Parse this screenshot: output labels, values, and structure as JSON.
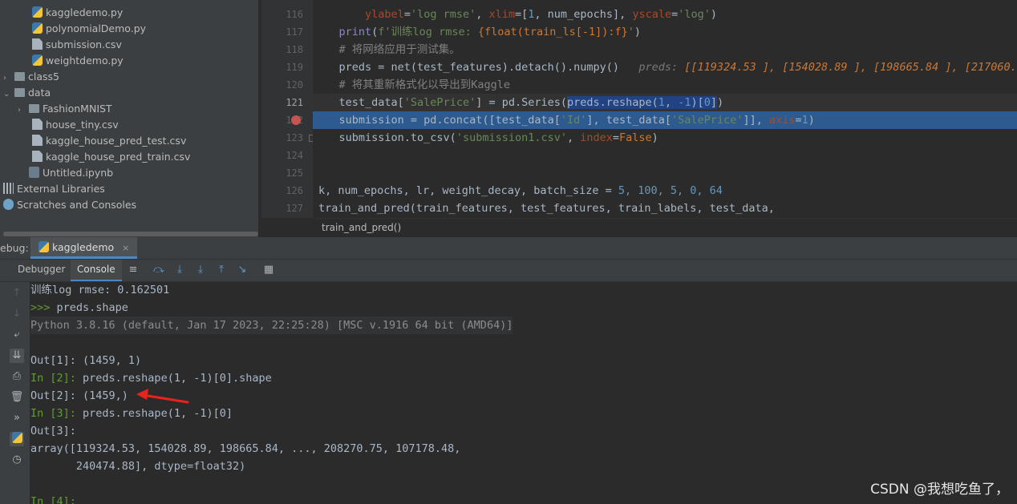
{
  "project_tree": {
    "items": [
      {
        "label": "kaggledemo.py",
        "icon": "python-file-icon",
        "indent": 2,
        "arrow": ""
      },
      {
        "label": "polynomialDemo.py",
        "icon": "python-file-icon",
        "indent": 2,
        "arrow": ""
      },
      {
        "label": "submission.csv",
        "icon": "csv-file-icon",
        "indent": 2,
        "arrow": ""
      },
      {
        "label": "weightdemo.py",
        "icon": "python-file-icon",
        "indent": 2,
        "arrow": ""
      },
      {
        "label": "class5",
        "icon": "folder-icon",
        "indent": 0,
        "arrow": "›"
      },
      {
        "label": "data",
        "icon": "folder-icon",
        "indent": 0,
        "arrow": "⌄"
      },
      {
        "label": "FashionMNIST",
        "icon": "folder-icon",
        "indent": 1,
        "arrow": "›"
      },
      {
        "label": "house_tiny.csv",
        "icon": "csv-file-icon",
        "indent": 2,
        "arrow": ""
      },
      {
        "label": "kaggle_house_pred_test.csv",
        "icon": "csv-file-icon",
        "indent": 2,
        "arrow": ""
      },
      {
        "label": "kaggle_house_pred_train.csv",
        "icon": "csv-file-icon",
        "indent": 2,
        "arrow": ""
      },
      {
        "label": "Untitled.ipynb",
        "icon": "notebook-file-icon",
        "indent": 1,
        "arrow": ""
      },
      {
        "label": "External Libraries",
        "icon": "libraries-icon",
        "indent": -1,
        "arrow": ""
      },
      {
        "label": "Scratches and Consoles",
        "icon": "scratches-icon",
        "indent": -1,
        "arrow": ""
      }
    ]
  },
  "editor": {
    "line_numbers": [
      "116",
      "117",
      "118",
      "119",
      "120",
      "121",
      "122",
      "123",
      "124",
      "125",
      "126",
      "127"
    ],
    "lines": {
      "l116_a": "        ",
      "l116_param": "ylabel",
      "l116_b": "=",
      "l116_s1": "'log rmse'",
      "l116_c": ", ",
      "l116_param2": "xlim",
      "l116_d": "=[",
      "l116_n1": "1",
      "l116_e": ", num_epochs], ",
      "l116_param3": "yscale",
      "l116_f": "=",
      "l116_s2": "'log'",
      "l116_g": ")",
      "l117_a": "    ",
      "l117_fn": "print",
      "l117_b": "(",
      "l117_s": "f'训练log rmse: ",
      "l117_c": "{float(train_ls[-1]):f}",
      "l117_s2": "'",
      "l117_d": ")",
      "l118": "    # 将网络应用于测试集。",
      "l119_a": "    preds = net(test_features).detach().numpy()   ",
      "l119_hint_lbl": "preds: ",
      "l119_hint": "[[119324.53 ], [154028.89 ], [198665.84 ], [217060.02",
      "l120": "    # 将其重新格式化以导出到Kaggle",
      "l121_a": "    test_data[",
      "l121_s": "'SalePrice'",
      "l121_b": "] = pd.Series(",
      "l121_sel": "preds.reshape(",
      "l121_n1": "1",
      "l121_c": ", ",
      "l121_n2": "-1",
      "l121_d": ")[",
      "l121_n3": "0",
      "l121_e": "]",
      "l121_f": ")",
      "l122_a": "    submission = pd.concat([test_data[",
      "l122_s1": "'Id'",
      "l122_b": "], test_data[",
      "l122_s2": "'SalePrice'",
      "l122_c": "]], ",
      "l122_param": "axis",
      "l122_d": "=",
      "l122_n": "1",
      "l122_e": ")",
      "l123_a": "    submission.to_csv(",
      "l123_s": "'submission1.csv'",
      "l123_b": ", ",
      "l123_param": "index",
      "l123_c": "=",
      "l123_kw": "False",
      "l123_d": ")",
      "l126_a": "k, num_epochs, lr, weight_decay, batch_size = ",
      "l126_n": "5, 100, 5, 0, 64",
      "l127": "train_and_pred(train_features, test_features, train_labels, test_data,"
    },
    "breadcrumb": "train_and_pred()"
  },
  "debug": {
    "label": "ebug:",
    "tab_label": "kaggledemo",
    "close": "×",
    "tabs": {
      "debugger": "Debugger",
      "console": "Console"
    },
    "console": {
      "l1": "训练log rmse: 0.162501",
      "l2_prompt": ">>> ",
      "l2_cmd": "preds.shape",
      "l3": "Python 3.8.16 (default, Jan 17 2023, 22:25:28) [MSC v.1916 64 bit (AMD64)]",
      "l5": "Out[1]: (1459, 1)",
      "l6_prompt": "In [2]: ",
      "l6_cmd": "preds.reshape(1, -1)[0].shape",
      "l7": "Out[2]: (1459,)",
      "l8_prompt": "In [3]: ",
      "l8_cmd": "preds.reshape(1, -1)[0]",
      "l9": "Out[3]: ",
      "l10": "array([119324.53, 154028.89, 198665.84, ..., 208270.75, 107178.48,",
      "l11": "       240474.88], dtype=float32)",
      "l13_prompt": "In [4]: "
    }
  },
  "watermark": "CSDN @我想吃鱼了，",
  "colors": {
    "selection": "#2d5b8f",
    "breakpoint": "#c75450",
    "arrow": "#e8231b"
  }
}
